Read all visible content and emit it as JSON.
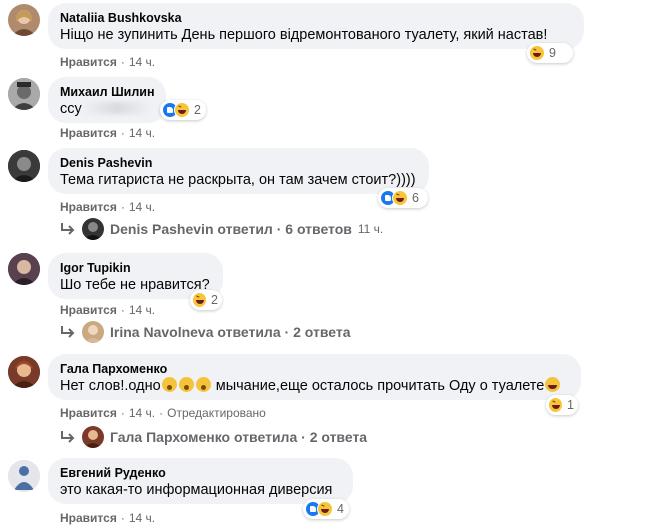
{
  "actions_like": "Нравится",
  "actions_edited": "Отредактировано",
  "comments": [
    {
      "author": "Nataliia Bushkovska",
      "text": "Ніщо не зупинить День першого відремонтованого туалету, який настав!",
      "reaction_count": "9",
      "time": "14 ч."
    },
    {
      "author": "Михаил Шилин",
      "text": "ссу",
      "reaction_count": "2",
      "time": "14 ч."
    },
    {
      "author": "Denis Pashevin",
      "text": "Тема гитариста не раскрыта, он там зачем стоит?))))",
      "reaction_count": "6",
      "time": "14 ч.",
      "reply": {
        "author": "Denis Pashevin",
        "verb": "ответил",
        "count": "6 ответов",
        "time": "11 ч."
      }
    },
    {
      "author": "Igor Tupikin",
      "text": "Шо тебе не нравится?",
      "reaction_count": "2",
      "time": "14 ч.",
      "reply": {
        "author": "Irina Navolneva",
        "verb": "ответила",
        "count": "2 ответа"
      }
    },
    {
      "author": "Гала Пархоменко",
      "text_before": "Нет слов!.одно",
      "text_after": " мычание,еще осталось прочитать Оду о туалете",
      "reaction_count": "1",
      "time": "14 ч.",
      "reply": {
        "author": "Гала Пархоменко",
        "verb": "ответила",
        "count": "2 ответа"
      }
    },
    {
      "author": "Евгений Руденко",
      "text": "это какая-то информационная диверсия",
      "reaction_count": "4",
      "time": "14 ч."
    }
  ],
  "colors": {
    "bubble": "#f0f2f5",
    "meta": "#65676b",
    "like_blue": "#1877f2",
    "haha_yellow": "#f7c43a"
  }
}
